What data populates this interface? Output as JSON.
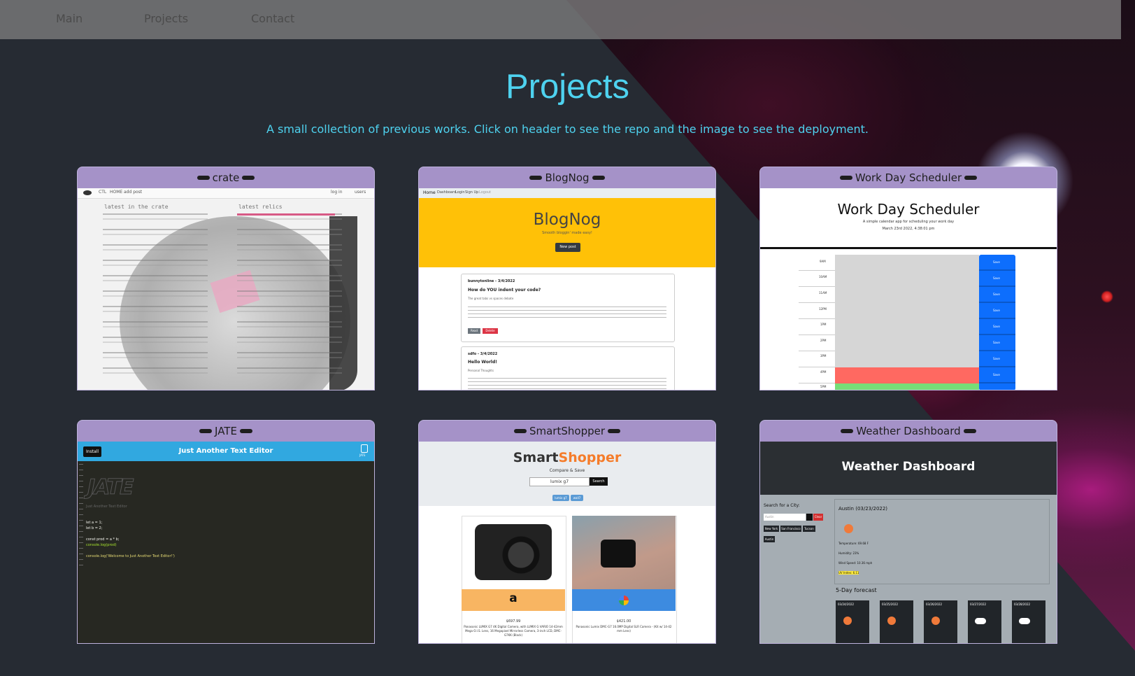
{
  "nav": {
    "links": [
      "Main",
      "Projects",
      "Contact"
    ]
  },
  "page": {
    "title": "Projects",
    "subtitle": "A small collection of previous works. Click on header to see the repo and the image to see the deployment."
  },
  "colors": {
    "accent": "#4ed2ef",
    "card_header": "#a592c8",
    "background": "#262b33"
  },
  "projects": [
    {
      "name": "crate",
      "preview": {
        "nav": [
          "CTL",
          "HOME",
          "add post"
        ],
        "nav_right": [
          "log in",
          "users"
        ],
        "col_left_title": "latest in the crate",
        "col_right_title": "latest relics"
      }
    },
    {
      "name": "BlogNog",
      "preview": {
        "nav": [
          "Home",
          "Dashboard",
          "Login",
          "Sign Up",
          "Logout"
        ],
        "hero_title": "BlogNog",
        "hero_sub": "Smooth bloggin' made easy!",
        "button": "New post",
        "post1_meta": "bunnytonline - 3/4/2022",
        "post1_title": "How do YOU indent your code?",
        "post1_sub": "The great tabs vs spaces debate",
        "post1_btn1": "Read",
        "post1_btn2": "Delete",
        "post2_meta": "sdfo - 3/4/2022",
        "post2_title": "Hello World!",
        "post2_sub": "Personal Thoughts"
      }
    },
    {
      "name": "Work Day Scheduler",
      "preview": {
        "title": "Work Day Scheduler",
        "sub": "A simple calendar app for scheduling your work day",
        "date": "March 23rd 2022, 4:38:01 pm",
        "hours": [
          "9AM",
          "10AM",
          "11AM",
          "12PM",
          "1PM",
          "2PM",
          "3PM",
          "4PM",
          "5PM"
        ],
        "save": "Save"
      }
    },
    {
      "name": "JATE",
      "preview": {
        "install": "Install",
        "title": "Just Another Text Editor",
        "logo": "JATE",
        "tagline": "Just Another Text Editor",
        "code1": "let a = 1;",
        "code2": "let b = 2;",
        "code3": "const prod = a * b;",
        "code4": "console.log(prod)",
        "code5": "console.log('Welcome to Just Another Text Editor!')"
      }
    },
    {
      "name": "SmartShopper",
      "preview": {
        "brand_a": "Smart",
        "brand_b": "Shopper",
        "tagline": "Compare & Save",
        "search_value": "lumix g7",
        "search_btn": "Search",
        "chips": [
          "lumix g7",
          "wall7"
        ],
        "price1": "$697.99",
        "desc1": "Panasonic LUMIX G7 4K Digital Camera, with LUMIX G VARIO 14-42mm Mega O.I.S. Lens, 16 Megapixel Mirrorless Camera, 3-inch LCD, DMC-G7KK (Black)",
        "price2": "$421.00",
        "desc2": "Panasonic Lumix DMC-G7 16.0MP Digital SLR Camera - (Kit w/ 14-42 mm Lens)",
        "store1": "a"
      }
    },
    {
      "name": "Weather Dashboard",
      "preview": {
        "title": "Weather Dashboard",
        "search_label": "Search for a City:",
        "search_placeholder": "Austin",
        "clear": "Clear",
        "cities": [
          "New York",
          "San Francisco",
          "Tucson",
          "Austin"
        ],
        "current": "Austin (03/23/2022)",
        "temp": "Temperature: 69.68 F",
        "humidity": "Humidity: 23%",
        "wind": "Wind Speed: 10.36 mph",
        "uv": "UV Index: 6.11",
        "forecast_title": "5-Day forecast",
        "forecast_dates": [
          "03/24/2022",
          "03/25/2022",
          "03/26/2022",
          "03/27/2022",
          "03/28/2022"
        ]
      }
    }
  ]
}
